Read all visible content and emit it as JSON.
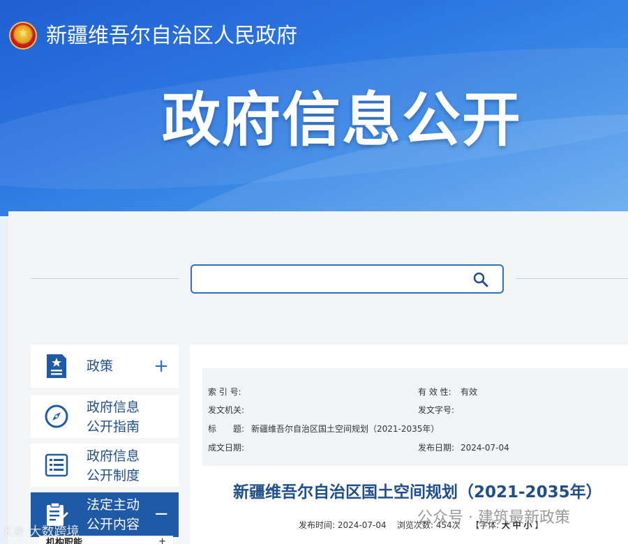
{
  "header": {
    "gov_name": "新疆维吾尔自治区人民政府",
    "title": "政府信息公开"
  },
  "search": {
    "placeholder": "",
    "value": ""
  },
  "sidebar": {
    "items": [
      {
        "label": "政策",
        "toggle": "+",
        "icon": "policy-document-icon"
      },
      {
        "label_line1": "政府信息",
        "label_line2": "公开指南",
        "icon": "compass-icon"
      },
      {
        "label_line1": "政府信息",
        "label_line2": "公开制度",
        "icon": "list-document-icon"
      },
      {
        "label_line1": "法定主动",
        "label_line2": "公开内容",
        "toggle": "−",
        "icon": "clipboard-edit-icon"
      }
    ],
    "sub_item": {
      "label": "机构职能",
      "toggle": "+"
    }
  },
  "meta": {
    "index_label": "索 引 号:",
    "index_value": "",
    "validity_label": "有 效 性:",
    "validity_value": "有效",
    "issuer_label": "发文机关:",
    "issuer_value": "",
    "docno_label": "发文字号:",
    "docno_value": "",
    "title_label": "标　　题:",
    "title_value": "新疆维吾尔自治区国土空间规划（2021-2035年）",
    "written_label": "成文日期:",
    "written_value": "",
    "publish_label": "发布日期:",
    "publish_value": "2024-07-04"
  },
  "document": {
    "title": "新疆维吾尔自治区国土空间规划（2021-2035年）",
    "publish_time_label": "发布时间:",
    "publish_time": "2024-07-04",
    "views_label": "浏览次数:",
    "views": "454次",
    "font_label": "【字体:",
    "font_large": "大",
    "font_medium": "中",
    "font_small": "小",
    "font_close": "】"
  },
  "watermarks": {
    "left": "K℗ 大数跨境",
    "right": "公众号 · 建筑最新政策"
  }
}
